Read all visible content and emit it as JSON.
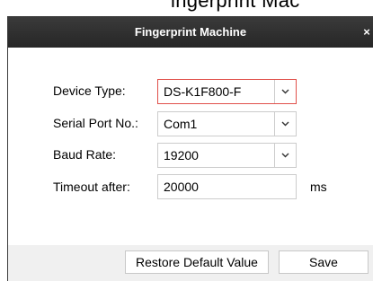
{
  "window": {
    "title": "Fingerprint Machine",
    "close_label": "×",
    "partial_top_text": "ingerprint Mac"
  },
  "form": {
    "device_type": {
      "label": "Device Type:",
      "value": "DS-K1F800-F"
    },
    "serial_port": {
      "label": "Serial Port No.:",
      "value": "Com1"
    },
    "baud_rate": {
      "label": "Baud Rate:",
      "value": "19200"
    },
    "timeout": {
      "label": "Timeout after:",
      "value": "20000",
      "unit": "ms"
    }
  },
  "footer": {
    "restore_label": "Restore Default Value",
    "save_label": "Save"
  },
  "icons": {
    "dropdown": "chevron-down-icon",
    "close": "close-icon"
  },
  "colors": {
    "titlebar": "#2e2e2e",
    "focus_border": "#e0504a",
    "panel_background": "#f0f0f0"
  }
}
